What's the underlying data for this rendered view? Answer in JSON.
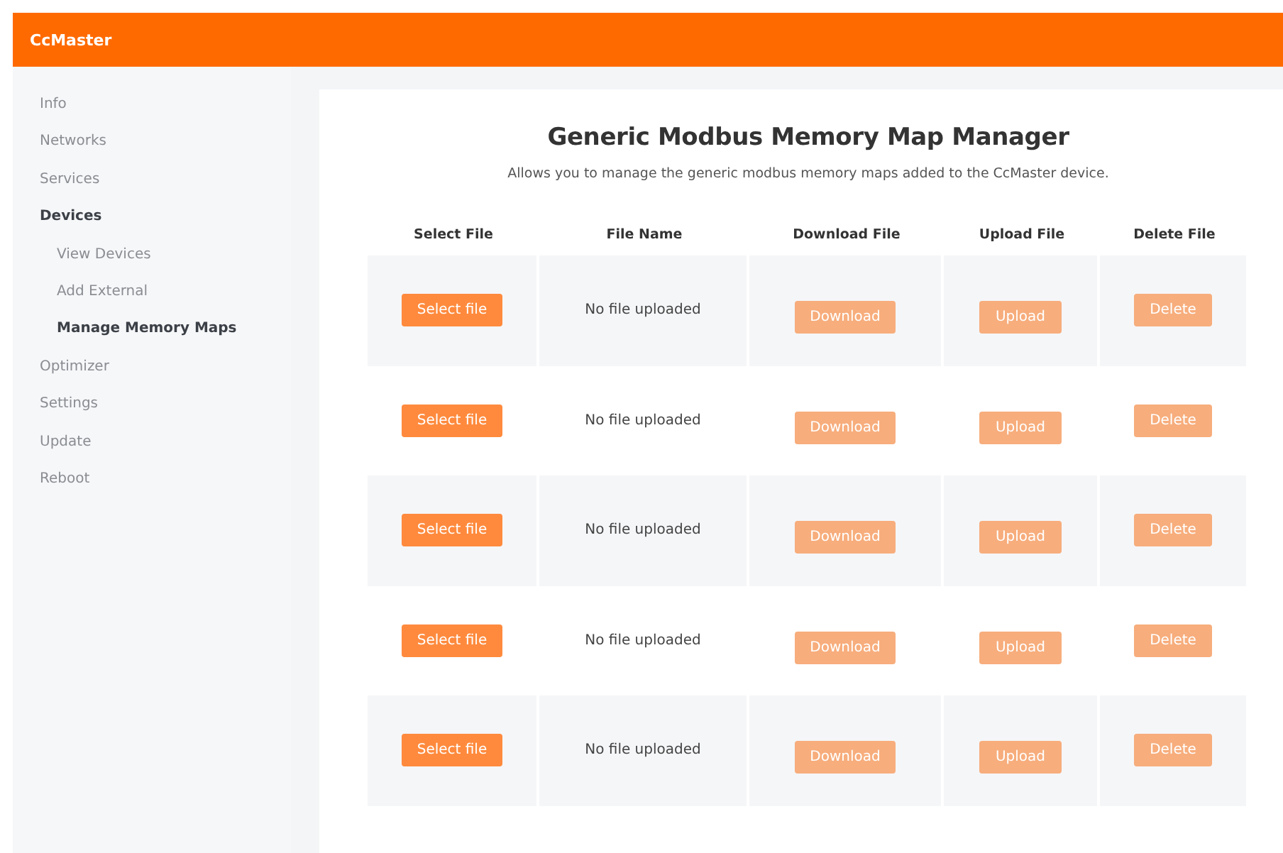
{
  "header": {
    "title": "CcMaster"
  },
  "sidebar": {
    "items": [
      {
        "label": "Info",
        "selected": false
      },
      {
        "label": "Networks",
        "selected": false
      },
      {
        "label": "Services",
        "selected": false
      },
      {
        "label": "Devices",
        "selected": true,
        "children": [
          {
            "label": "View Devices",
            "selected": false
          },
          {
            "label": "Add External",
            "selected": false
          },
          {
            "label": "Manage Memory Maps",
            "selected": true
          }
        ]
      },
      {
        "label": "Optimizer",
        "selected": false
      },
      {
        "label": "Settings",
        "selected": false
      },
      {
        "label": "Update",
        "selected": false
      },
      {
        "label": "Reboot",
        "selected": false
      }
    ]
  },
  "main": {
    "title": "Generic Modbus Memory Map Manager",
    "subtitle": "Allows you to manage the generic modbus memory maps added to the CcMaster device.",
    "table": {
      "columns": [
        "Select File",
        "File Name",
        "Download File",
        "Upload File",
        "Delete File"
      ],
      "rows": [
        {
          "select": {
            "label": "Select file",
            "disabled": false
          },
          "file_name": "No file uploaded",
          "download": {
            "label": "Download",
            "disabled": true
          },
          "upload": {
            "label": "Upload",
            "disabled": true
          },
          "delete": {
            "label": "Delete",
            "disabled": true
          }
        },
        {
          "select": {
            "label": "Select file",
            "disabled": false
          },
          "file_name": "No file uploaded",
          "download": {
            "label": "Download",
            "disabled": true
          },
          "upload": {
            "label": "Upload",
            "disabled": true
          },
          "delete": {
            "label": "Delete",
            "disabled": true
          }
        },
        {
          "select": {
            "label": "Select file",
            "disabled": false
          },
          "file_name": "No file uploaded",
          "download": {
            "label": "Download",
            "disabled": true
          },
          "upload": {
            "label": "Upload",
            "disabled": true
          },
          "delete": {
            "label": "Delete",
            "disabled": true
          }
        },
        {
          "select": {
            "label": "Select file",
            "disabled": false
          },
          "file_name": "No file uploaded",
          "download": {
            "label": "Download",
            "disabled": true
          },
          "upload": {
            "label": "Upload",
            "disabled": true
          },
          "delete": {
            "label": "Delete",
            "disabled": true
          }
        },
        {
          "select": {
            "label": "Select file",
            "disabled": false
          },
          "file_name": "No file uploaded",
          "download": {
            "label": "Download",
            "disabled": true
          },
          "upload": {
            "label": "Upload",
            "disabled": true
          },
          "delete": {
            "label": "Delete",
            "disabled": true
          }
        }
      ]
    }
  }
}
